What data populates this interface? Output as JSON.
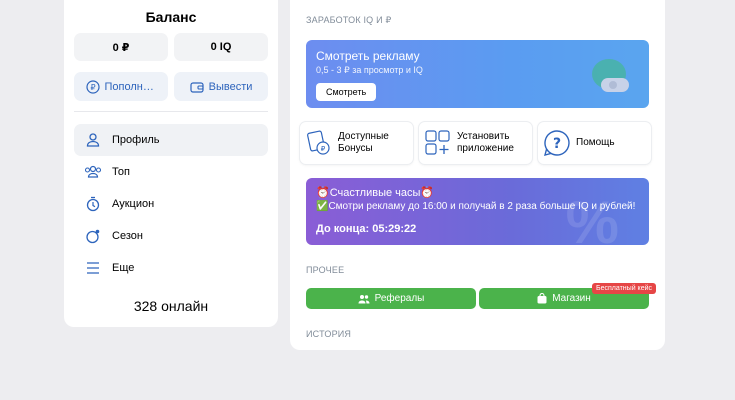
{
  "balance": {
    "title": "Баланс",
    "rub": "0 ₽",
    "iq": "0 IQ",
    "topup_label": "Пополнить",
    "withdraw_label": "Вывести"
  },
  "nav": {
    "items": [
      {
        "label": "Профиль",
        "icon": "user-icon",
        "active": true
      },
      {
        "label": "Топ",
        "icon": "users-icon"
      },
      {
        "label": "Аукцион",
        "icon": "stopwatch-icon"
      },
      {
        "label": "Сезон",
        "icon": "season-icon"
      },
      {
        "label": "Еще",
        "icon": "menu-icon"
      }
    ]
  },
  "online": "328 онлайн",
  "earn": {
    "heading": "Заработок IQ и ₽",
    "ad_title": "Смотреть рекламу",
    "ad_subtitle": "0,5 - 3 ₽ за просмотр и IQ",
    "ad_button": "Смотреть"
  },
  "tiles": [
    {
      "label": "Доступные Бонусы",
      "icon": "bonus-icon"
    },
    {
      "label": "Установить приложение",
      "icon": "apps-icon"
    },
    {
      "label": "Помощь",
      "icon": "help-icon"
    }
  ],
  "happy_hours": {
    "title": "⏰Счастливые часы⏰",
    "text": "✅Смотри рекламу до 16:00 и получай в 2 раза больше IQ и рублей!",
    "countdown": "До конца: 05:29:22"
  },
  "other": {
    "heading": "Прочее",
    "referrals_label": "Рефералы",
    "shop_label": "Магазин",
    "shop_badge": "Бесплатный кейс"
  },
  "history_heading": "История",
  "colors": {
    "accent": "#2d64bc",
    "green": "#4bb34b",
    "badge_red": "#e64646"
  }
}
